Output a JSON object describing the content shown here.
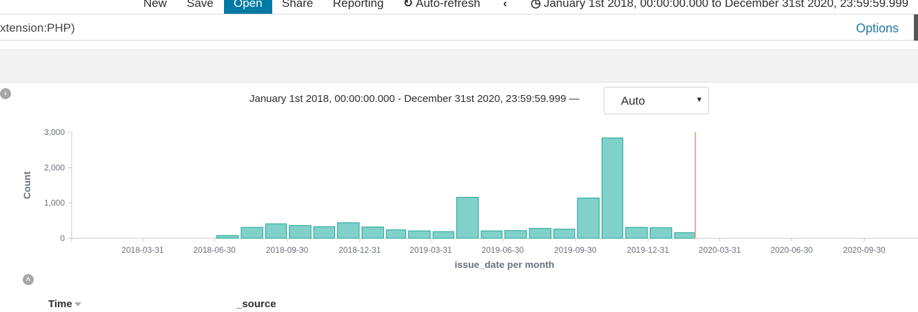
{
  "toolbar": {
    "new_label": "New",
    "save_label": "Save",
    "open_label": "Open",
    "share_label": "Share",
    "reporting_label": "Reporting",
    "auto_refresh_label": "Auto-refresh",
    "time_range_label": "January 1st 2018, 00:00:00.000 to December 31st 2020, 23:59:59.999"
  },
  "query": {
    "text": "xtension:PHP)",
    "options_label": "Options"
  },
  "histogram": {
    "range_label": "January 1st 2018, 00:00:00.000 - December 31st 2020, 23:59:59.999 —",
    "interval_value": "Auto"
  },
  "table": {
    "time_header": "Time",
    "source_header": "_source"
  },
  "colors": {
    "accent": "#0079a5",
    "bar_fill": "#7fd1ca",
    "bar_stroke": "#1ea595",
    "now_marker": "#f2a49c",
    "link": "#1f7aa6"
  },
  "icons": {
    "refresh": "refresh-icon",
    "back": "chevron-left-icon",
    "clock": "clock-icon",
    "collapse_left": "collapse-left-icon",
    "collapse_up": "collapse-up-icon",
    "sort": "sort-caret-icon"
  },
  "chart_data": {
    "type": "bar",
    "xlabel": "issue_date per month",
    "ylabel": "Count",
    "ylim": [
      0,
      3000
    ],
    "yticks": [
      0,
      1000,
      2000,
      3000
    ],
    "ytick_labels": [
      "0",
      "1,000",
      "2,000",
      "3,000"
    ],
    "xlim": [
      "2018-01-01",
      "2020-12-31"
    ],
    "xtick_labels": [
      "2018-03-31",
      "2018-06-30",
      "2018-09-30",
      "2018-12-31",
      "2019-03-31",
      "2019-06-30",
      "2019-09-30",
      "2019-12-31",
      "2020-03-31",
      "2020-06-30",
      "2020-09-30"
    ],
    "categories": [
      "2018-07",
      "2018-08",
      "2018-09",
      "2018-10",
      "2018-11",
      "2018-12",
      "2019-01",
      "2019-02",
      "2019-03",
      "2019-04",
      "2019-05",
      "2019-06",
      "2019-07",
      "2019-08",
      "2019-09",
      "2019-10",
      "2019-11",
      "2019-12",
      "2020-01",
      "2020-02"
    ],
    "values": [
      80,
      310,
      410,
      360,
      330,
      440,
      320,
      240,
      210,
      190,
      1160,
      210,
      220,
      280,
      260,
      1140,
      2840,
      310,
      300,
      160
    ],
    "now_marker": "2020-02-29",
    "grid": false,
    "legend": "none"
  }
}
